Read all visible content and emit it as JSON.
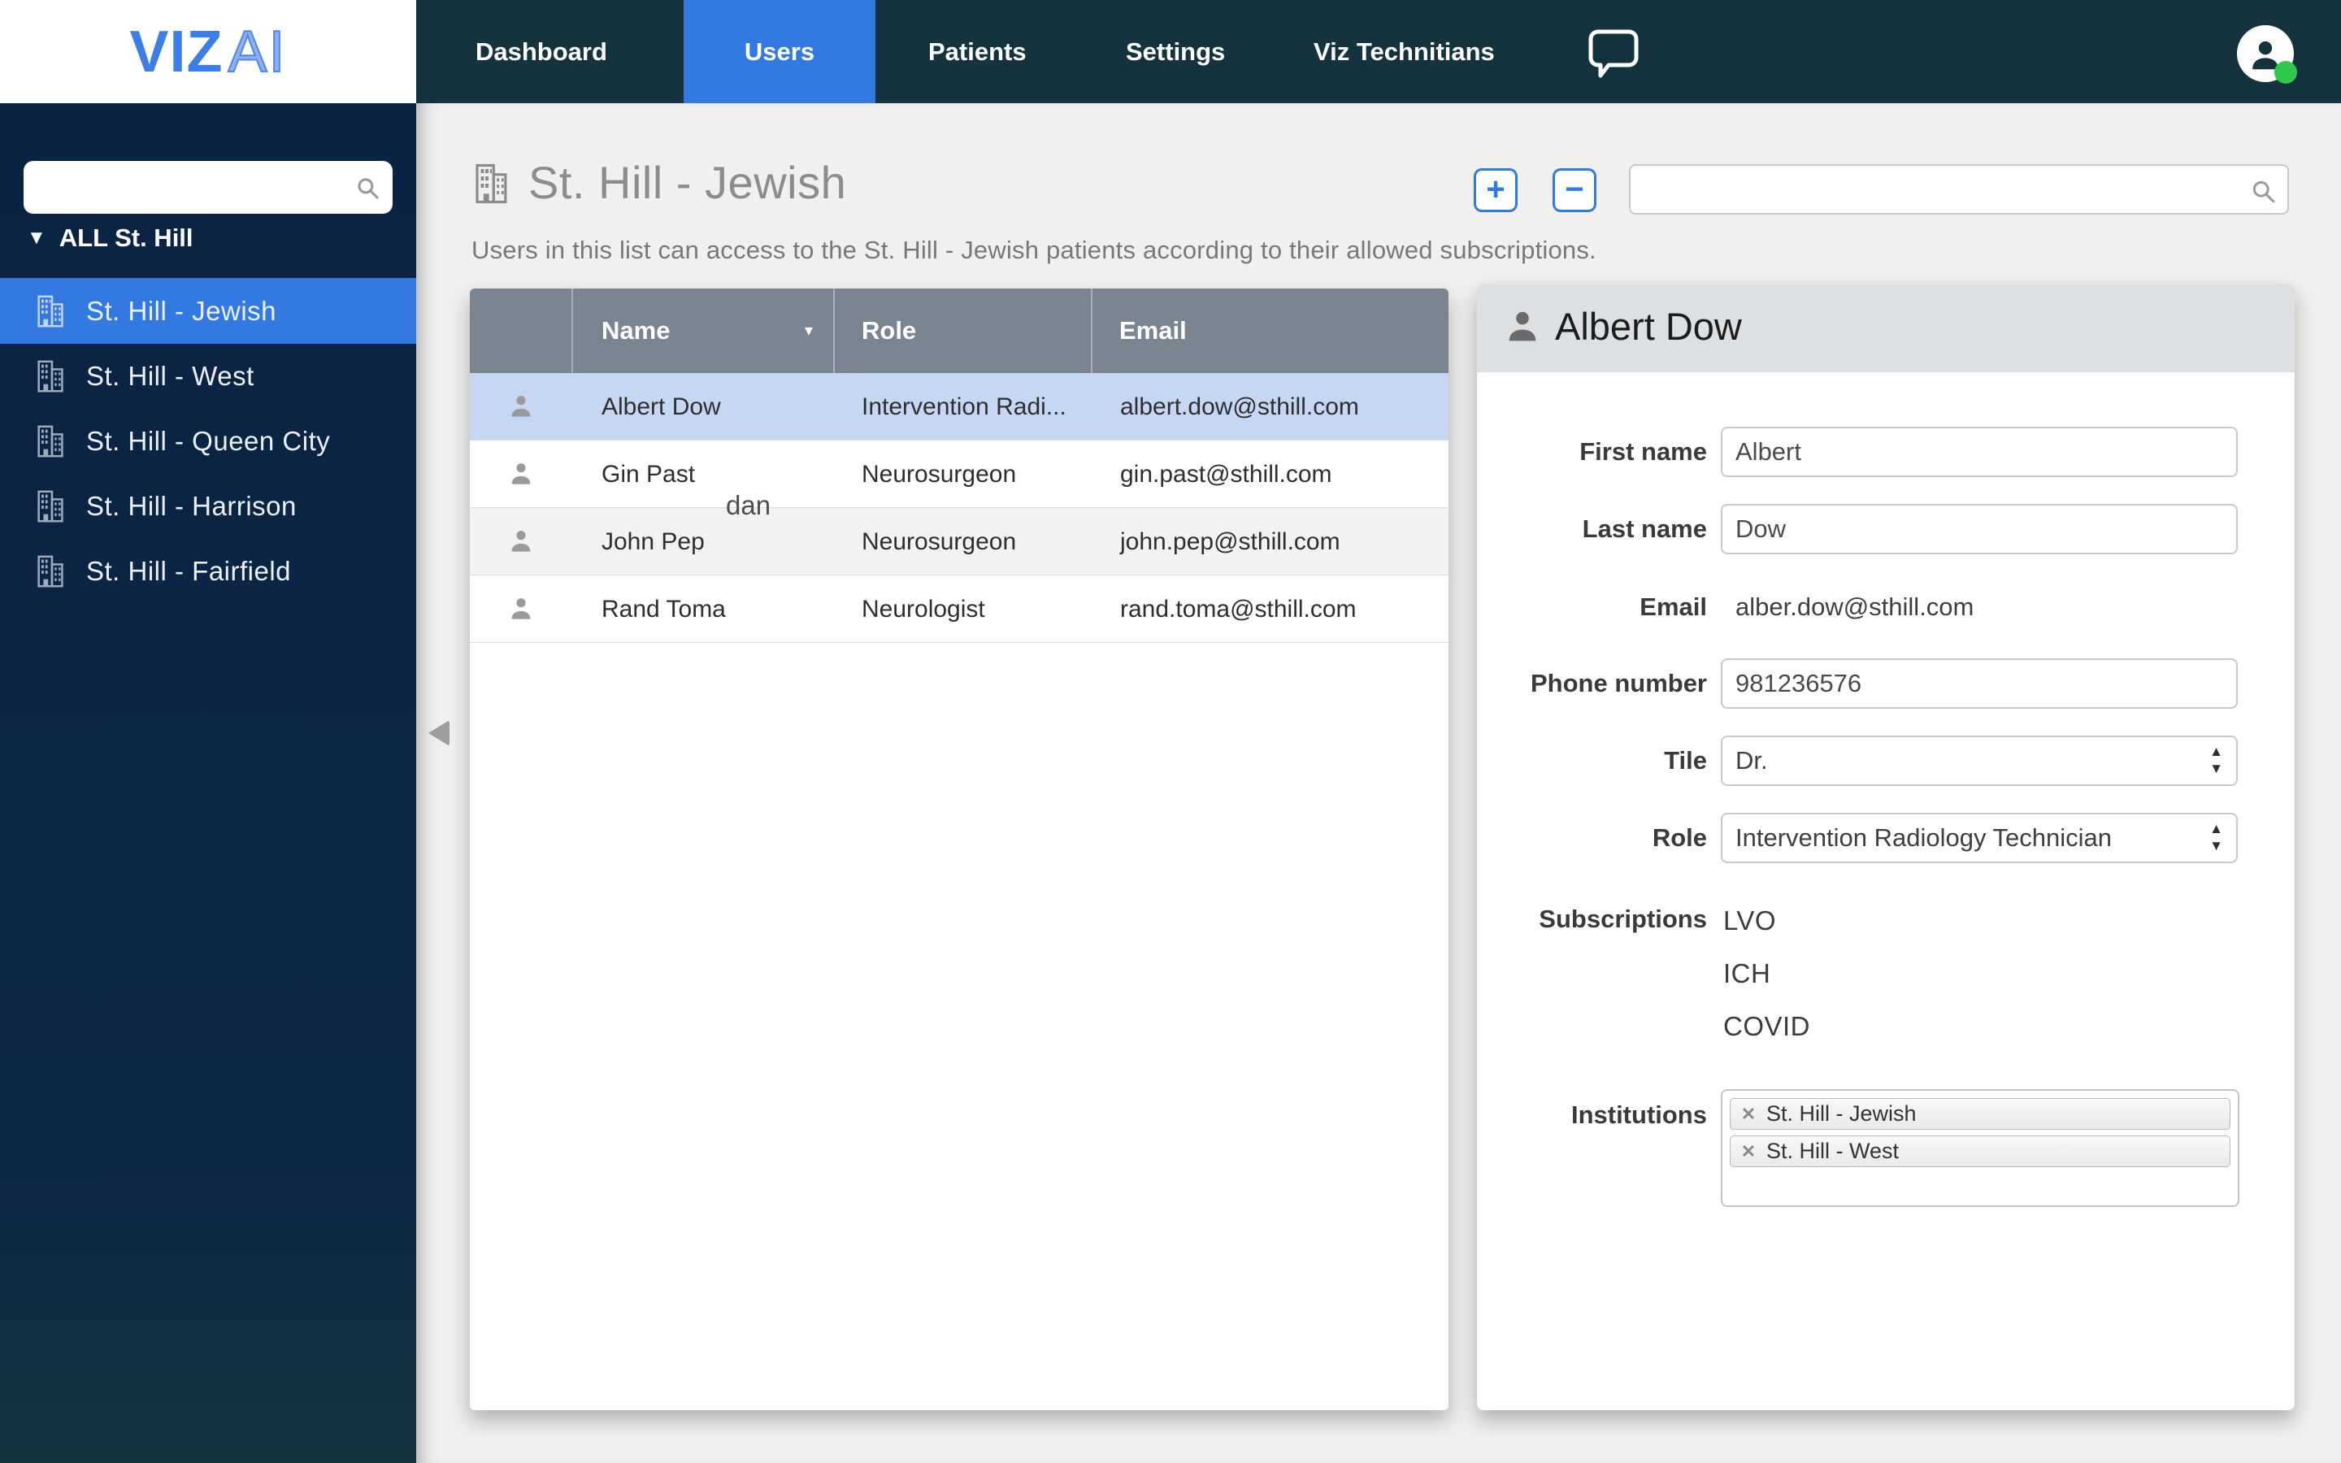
{
  "colors": {
    "navbar_bg": "#14333F",
    "sidebar_bg": "#0C2443",
    "accent_blue": "#3379E2",
    "logo_blue": "#3C7DE8",
    "selected_row": "#C5D7F2",
    "table_header": "#7A8591",
    "online_green": "#2FC74C",
    "main_bg": "#F0F0EF"
  },
  "brand": {
    "viz": "VIZ",
    "ai": "AI"
  },
  "navbar": {
    "items": [
      {
        "label": "Dashboard"
      },
      {
        "label": "Users"
      },
      {
        "label": "Patients"
      },
      {
        "label": "Settings"
      },
      {
        "label": "Viz Technitians"
      }
    ]
  },
  "sidebar": {
    "search_value": "",
    "group_label": "ALL St. Hill",
    "items": [
      {
        "label": "St. Hill - Jewish"
      },
      {
        "label": "St. Hill - West"
      },
      {
        "label": "St. Hill - Queen City"
      },
      {
        "label": "St. Hill - Harrison"
      },
      {
        "label": "St. Hill - Fairfield"
      }
    ]
  },
  "main": {
    "title": "St. Hill - Jewish",
    "subtitle": "Users in this list can access to the St. Hill - Jewish patients according to their allowed subscriptions.",
    "add_label": "+",
    "remove_label": "−",
    "search_value": "",
    "table": {
      "columns": [
        "Name",
        "Role",
        "Email"
      ],
      "sort_arrow": "▾",
      "floating_text": "dan",
      "rows": [
        {
          "name": "Albert Dow",
          "role": "Intervention Radi...",
          "email": "albert.dow@sthill.com"
        },
        {
          "name": "Gin Past",
          "role": "Neurosurgeon",
          "email": "gin.past@sthill.com"
        },
        {
          "name": "John Pep",
          "role": "Neurosurgeon",
          "email": "john.pep@sthill.com"
        },
        {
          "name": "Rand Toma",
          "role": "Neurologist",
          "email": "rand.toma@sthill.com"
        }
      ]
    },
    "detail": {
      "title": "Albert Dow",
      "first_name_label": "First name",
      "first_name": "Albert",
      "last_name_label": "Last name",
      "last_name": "Dow",
      "email_label": "Email",
      "email": "alber.dow@sthill.com",
      "phone_label": "Phone number",
      "phone": "981236576",
      "title_label": "Tile",
      "title_value": "Dr.",
      "role_label": "Role",
      "role_value": "Intervention Radiology Technician",
      "subscriptions_label": "Subscriptions",
      "subscriptions": [
        "LVO",
        "ICH",
        "COVID"
      ],
      "institutions_label": "Institutions",
      "institutions": [
        {
          "remove": "✕",
          "label": "St. Hill - Jewish"
        },
        {
          "remove": "✕",
          "label": "St. Hill - West"
        }
      ]
    }
  }
}
